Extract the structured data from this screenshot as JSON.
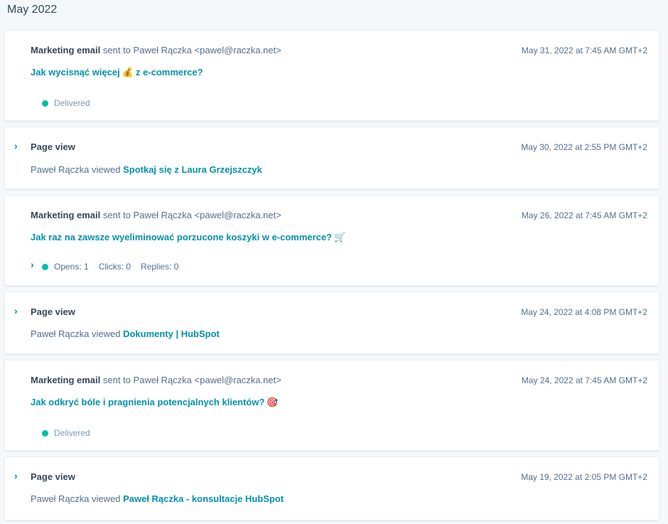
{
  "month_header": "May 2022",
  "colors": {
    "link": "#0091ae",
    "status_dot": "#00bda5",
    "text": "#33475b"
  },
  "events": [
    {
      "type": "Marketing email",
      "verb": "sent to",
      "recipient": "Paweł Rączka <pawel@raczka.net>",
      "timestamp": "May 31, 2022 at 7:45 AM GMT+2",
      "subject": "Jak wycisnąć więcej",
      "subject_emoji": "💰",
      "subject_suffix": "z e-commerce?",
      "status": "Delivered"
    },
    {
      "type": "Page view",
      "timestamp": "May 30, 2022 at 2:55 PM GMT+2",
      "actor": "Paweł Rączka viewed",
      "page": "Spotkaj się z Laura Grzejszczyk"
    },
    {
      "type": "Marketing email",
      "verb": "sent to",
      "recipient": "Paweł Rączka <pawel@raczka.net>",
      "timestamp": "May 26, 2022 at 7:45 AM GMT+2",
      "subject": "Jak raz na zawsze wyeliminować porzucone koszyki w e-commerce?",
      "subject_emoji": "🛒",
      "opens": "Opens: 1",
      "clicks": "Clicks: 0",
      "replies": "Replies: 0"
    },
    {
      "type": "Page view",
      "timestamp": "May 24, 2022 at 4:08 PM GMT+2",
      "actor": "Paweł Rączka viewed",
      "page": "Dokumenty | HubSpot"
    },
    {
      "type": "Marketing email",
      "verb": "sent to",
      "recipient": "Paweł Rączka <pawel@raczka.net>",
      "timestamp": "May 24, 2022 at 7:45 AM GMT+2",
      "subject": "Jak odkryć bóle i pragnienia potencjalnych klientów?",
      "subject_emoji": "🎯",
      "status": "Delivered"
    },
    {
      "type": "Page view",
      "timestamp": "May 19, 2022 at 2:05 PM GMT+2",
      "actor": "Paweł Rączka viewed",
      "page": "Paweł Rączka - konsultacje HubSpot"
    }
  ]
}
